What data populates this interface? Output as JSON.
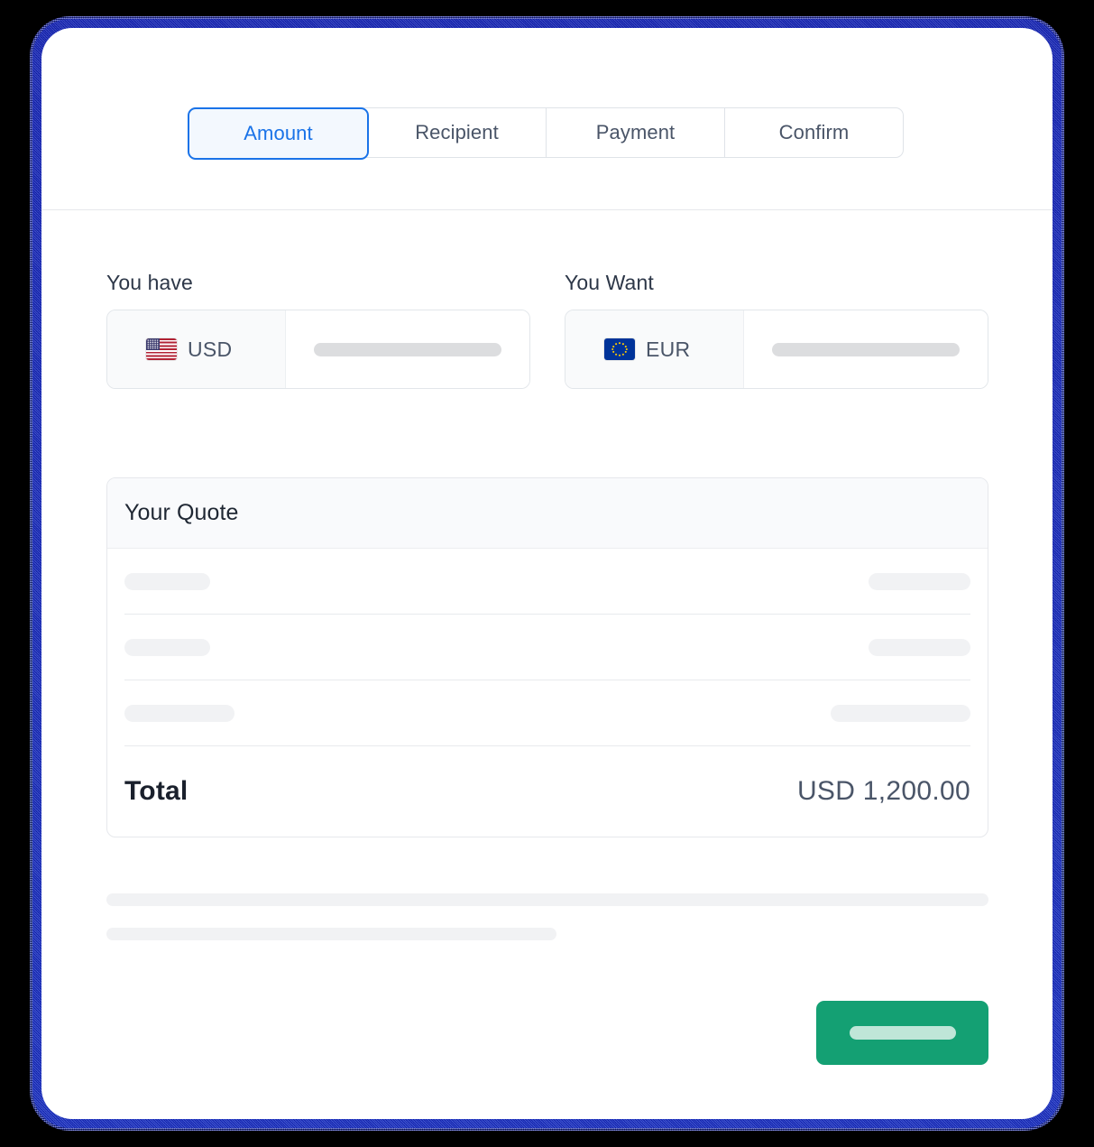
{
  "wizard": {
    "tabs": [
      {
        "label": "Amount",
        "active": true
      },
      {
        "label": "Recipient",
        "active": false
      },
      {
        "label": "Payment",
        "active": false
      },
      {
        "label": "Confirm",
        "active": false
      }
    ],
    "active_tab": "Amount"
  },
  "amount_step": {
    "source": {
      "label": "You have",
      "currency_code": "USD",
      "flag": "us-flag-icon",
      "amount_value": "",
      "amount_placeholder": ""
    },
    "target": {
      "label": "You Want",
      "currency_code": "EUR",
      "flag": "eu-flag-icon",
      "amount_value": "",
      "amount_placeholder": ""
    }
  },
  "quote": {
    "title": "Your Quote",
    "rows": [
      {
        "label": "",
        "value": ""
      },
      {
        "label": "",
        "value": ""
      },
      {
        "label": "",
        "value": ""
      }
    ],
    "total_label": "Total",
    "total_value": "USD 1,200.00"
  },
  "footer": {
    "note_line_1": "",
    "note_line_2": "",
    "cta_label": ""
  },
  "colors": {
    "accent_blue": "#1a73e8",
    "active_tab_bg": "#f3f8fe",
    "cta_green": "#14a073",
    "cta_skeleton": "#bfe6d8",
    "total_value": "#4a5568",
    "skeleton_light": "#f1f2f4",
    "skeleton_dark": "#dcdddf",
    "frame_blue": "#1726c8",
    "page_background": "#000000",
    "card_background": "#ffffff",
    "eu_flag_blue": "#003399",
    "eu_flag_star": "#ffcc00",
    "us_flag_red": "#b22234",
    "us_flag_navy": "#3c3b6e"
  }
}
